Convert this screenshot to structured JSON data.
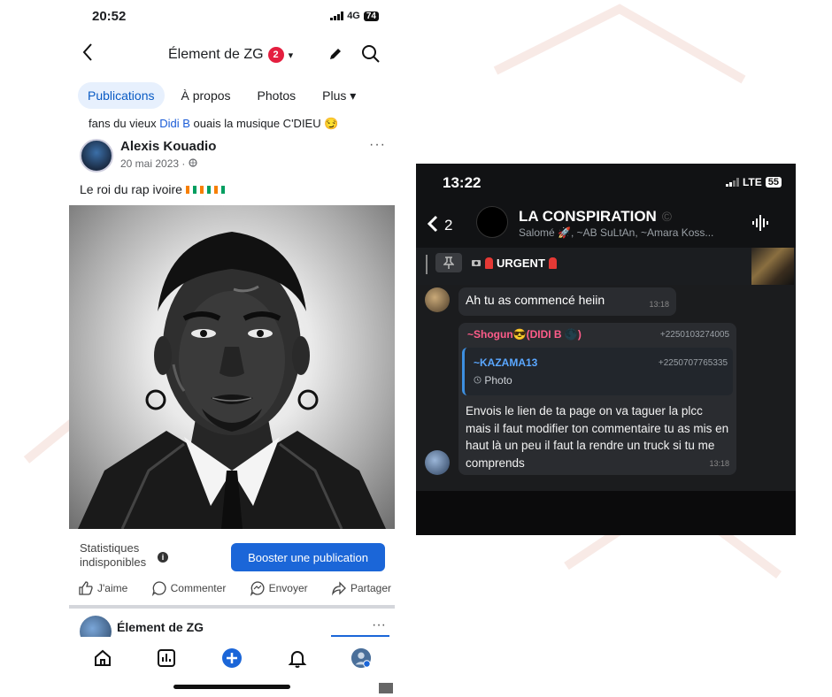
{
  "facebook": {
    "status": {
      "time": "20:52",
      "network": "4G",
      "battery": "74"
    },
    "header": {
      "back_icon": "chevron-left-icon",
      "title": "Élement de ZG",
      "notif_count": "2",
      "caret": "▾"
    },
    "tabs": [
      {
        "label": "Publications",
        "active": true
      },
      {
        "label": "À propos"
      },
      {
        "label": "Photos"
      },
      {
        "label": "Plus ▾"
      }
    ],
    "snippet": {
      "before": "fans du vieux ",
      "link": "Didi B",
      "after": " ouais la musique C'DIEU 😏"
    },
    "post": {
      "author": "Alexis Kouadio",
      "date": "20 mai 2023 · ",
      "privacy_icon": "globe-icon",
      "text": "Le roi du rap ivoire",
      "image_alt": "black and white portrait illustration"
    },
    "stats_label_line1": "Statistiques",
    "stats_label_line2": "indisponibles",
    "info_icon": "i",
    "boost_label": "Booster une publication",
    "actions": [
      {
        "icon": "thumbs-up-icon",
        "label": "J'aime"
      },
      {
        "icon": "comment-icon",
        "label": "Commenter"
      },
      {
        "icon": "messenger-icon",
        "label": "Envoyer"
      },
      {
        "icon": "share-icon",
        "label": "Partager"
      }
    ],
    "next_post_author": "Élement de ZG",
    "menu_dots": "···"
  },
  "telegram": {
    "status": {
      "time": "13:22",
      "network": "LTE",
      "battery": "55"
    },
    "header": {
      "back_count": "2",
      "title": "LA CONSPIRATION",
      "title_badge": "©",
      "subtitle": "Salomé 🚀, ~AB SuLtAn, ~Amara Koss..."
    },
    "pinned": {
      "label": "URGENT"
    },
    "messages": [
      {
        "text": "Ah tu as commencé heiin",
        "time": "13:18"
      },
      {
        "sender": "~Shogun😎(DIDI B 🌑)",
        "phone": "+2250103274005",
        "reply_sender": "~KAZAMA13",
        "reply_phone": "+2250707765335",
        "reply_text": "Photo",
        "text": "Envois le lien de ta page on va taguer la plcc mais il faut modifier ton commentaire tu as mis en haut là un peu il faut la rendre un truck si tu me comprends",
        "time": "13:18"
      }
    ]
  }
}
